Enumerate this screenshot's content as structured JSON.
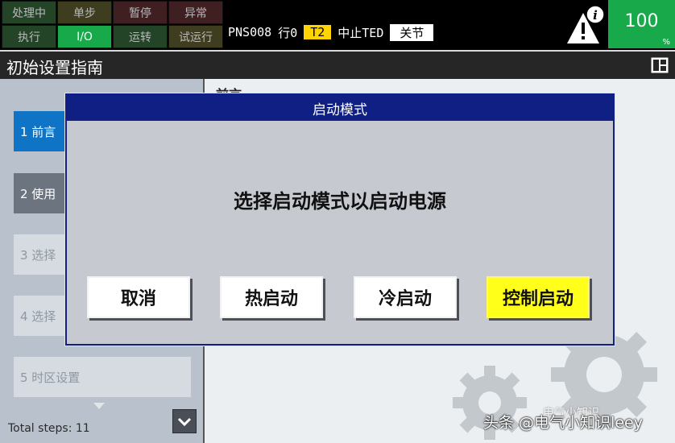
{
  "status": {
    "row1": [
      "处理中",
      "单步",
      "暂停",
      "异常"
    ],
    "row2": [
      "执行",
      "I/O",
      "运转",
      "试运行"
    ]
  },
  "toolbar": {
    "program": "PNS008",
    "line": "行0",
    "tool": "T2",
    "state": "中止TED",
    "joint": "关节"
  },
  "battery": {
    "value": "100",
    "unit": "%"
  },
  "header": {
    "title": "初始设置指南"
  },
  "sidebar": {
    "steps": [
      {
        "label": "1  前言"
      },
      {
        "label": "2  使用"
      },
      {
        "label": "3  选择"
      },
      {
        "label": "4  选择"
      },
      {
        "label": "5  时区设置"
      }
    ],
    "total": "Total steps: 11"
  },
  "main": {
    "heading": "前言"
  },
  "dialog": {
    "title": "启动模式",
    "message": "选择启动模式以启动电源",
    "buttons": {
      "cancel": "取消",
      "hot": "热启动",
      "cold": "冷启动",
      "control": "控制启动"
    }
  },
  "watermark": {
    "line1": "电气小知识",
    "line2": "头条 @电气小知识leey"
  },
  "colors": {
    "active_step": "#1074c6",
    "dialog_title": "#0f1f84",
    "control_button": "#ffff19",
    "battery": "#18a94b"
  }
}
